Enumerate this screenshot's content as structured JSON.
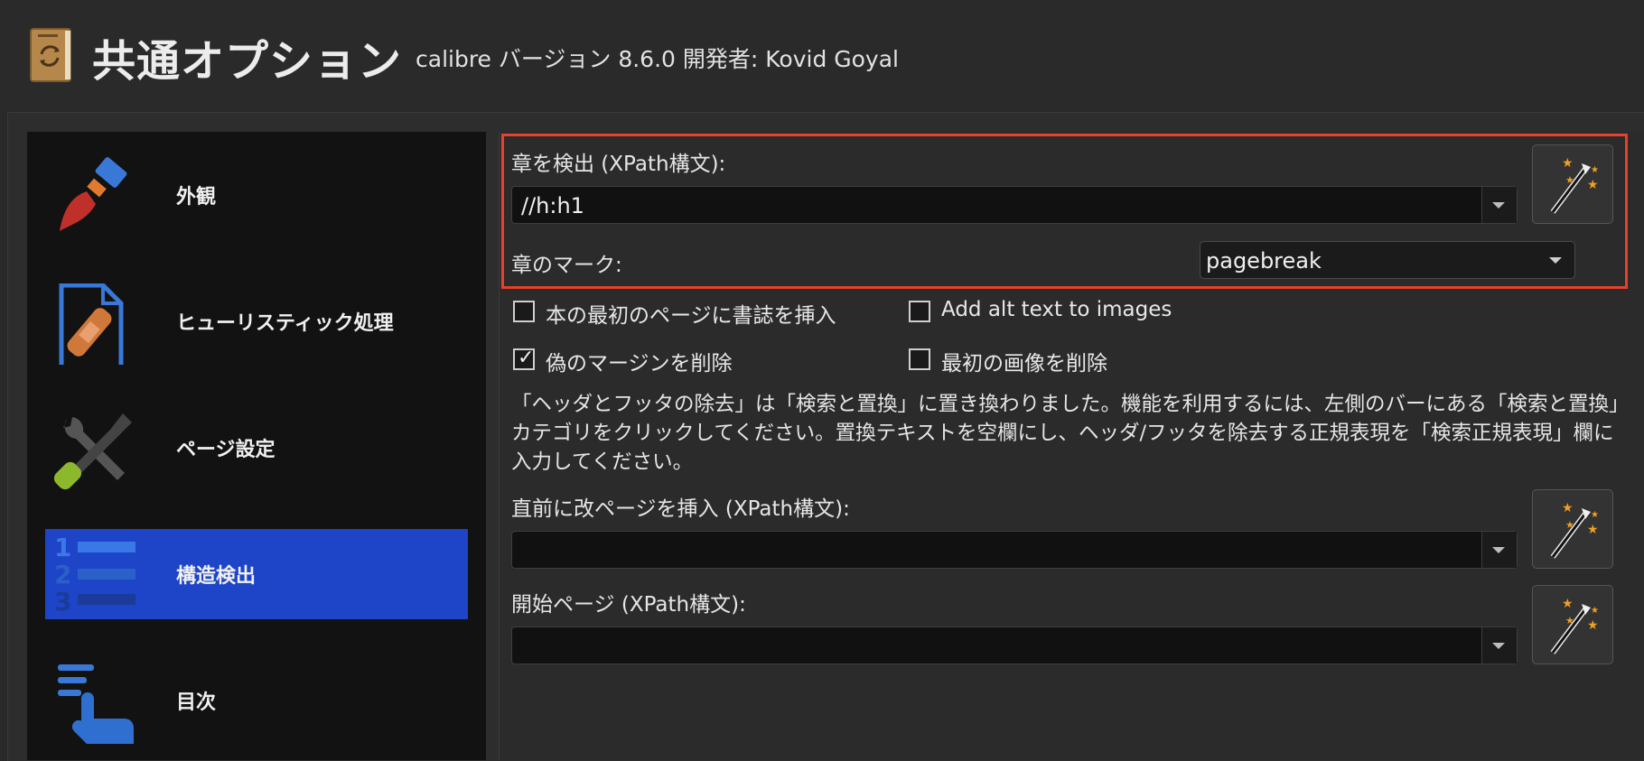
{
  "header": {
    "title": "共通オプション",
    "subtitle": "calibre バージョン 8.6.0 開発者: Kovid Goyal"
  },
  "sidebar": {
    "items": [
      {
        "label": "外観",
        "icon": "paintbrush-icon"
      },
      {
        "label": "ヒューリスティック処理",
        "icon": "bandaged-document-icon"
      },
      {
        "label": "ページ設定",
        "icon": "tools-icon"
      },
      {
        "label": "構造検出",
        "icon": "numbered-list-icon",
        "selected": true
      },
      {
        "label": "目次",
        "icon": "toc-hand-icon"
      }
    ]
  },
  "main": {
    "chapter_detect": {
      "label": "章を検出 (XPath構文):",
      "value": "//h:h1"
    },
    "chapter_mark": {
      "label": "章のマーク:",
      "value": "pagebreak"
    },
    "checkboxes": [
      {
        "label": "本の最初のページに書誌を挿入",
        "checked": false
      },
      {
        "label": "Add alt text to images",
        "checked": false
      },
      {
        "label": "偽のマージンを削除",
        "checked": true
      },
      {
        "label": "最初の画像を削除",
        "checked": false
      }
    ],
    "checkmark": "✓",
    "note": "「ヘッダとフッタの除去」は「検索と置換」に置き換わりました。機能を利用するには、左側のバーにある「検索と置換」カテゴリをクリックしてください。置換テキストを空欄にし、ヘッダ/フッタを除去する正規表現を「検索正規表現」欄に入力してください。",
    "page_break_before": {
      "label": "直前に改ページを挿入 (XPath構文):",
      "value": ""
    },
    "start_page": {
      "label": "開始ページ (XPath構文):",
      "value": ""
    }
  },
  "colors": {
    "accent_selected": "#1e44c8",
    "highlight_border": "#e8402a"
  }
}
